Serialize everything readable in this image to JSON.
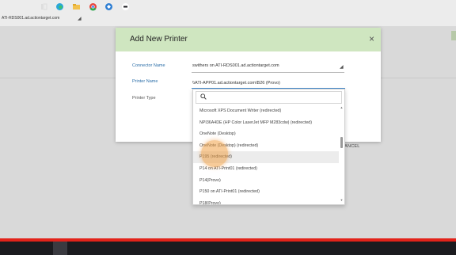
{
  "background": {
    "connector_text": "ATI-RDS001.ad.actiontarget.com",
    "caret": "◢"
  },
  "dialog": {
    "title": "Add New Printer",
    "close_icon": "×",
    "connector_label": "Connector Name",
    "connector_value": "swithers on ATI-RDS001.ad.actiontarget.com",
    "connector_caret": "◢",
    "printer_label": "Printer Name",
    "printer_value": "\\\\ATI-APP01.ad.actiontarget.com\\B26 (Provo)",
    "printer_type_label": "Printer Type",
    "cancel_label": "CANCEL"
  },
  "dropdown": {
    "search_icon": "search-icon",
    "items": [
      "Microsoft XPS Document Writer (redirected)",
      "NPI36A4DE (HP Color LaserJet MFP M283cdw) (redirected)",
      "OneNote (Desktop)",
      "OneNote (Desktop) (redirected)",
      "P195 (redirected)",
      "P14 on ATI-Print01 (redirected)",
      "P14(Provo)",
      "P150 on ATI-Print01 (redirected)",
      "P18(Provo)"
    ],
    "highlighted_index": 4,
    "scroll_up": "▲",
    "scroll_down": "▼"
  },
  "taskbar": {
    "icons": [
      "task-view-icon",
      "edge-icon",
      "file-explorer-icon",
      "chrome-icon",
      "remote-desktop-icon",
      "chat-icon"
    ]
  },
  "colors": {
    "header_bg": "#cfe6c0",
    "link_label": "#2b6ea8",
    "click_marker": "#f0a046",
    "red_bar": "#e2231a"
  }
}
